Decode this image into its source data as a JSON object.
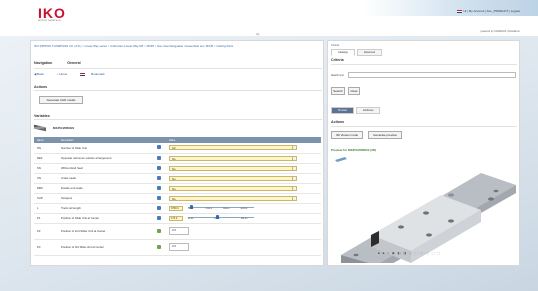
{
  "header": {
    "logo_text": "IKO",
    "logo_sub": "NIPPON THOMPSON",
    "user_line": "Hi | My Account | ALL_PRODUCT | Logout",
    "powered": "powered by CADENAS | Disclaimer",
    "center_mark": "top"
  },
  "breadcrumb": "IKO (NIPPON THOMPSON CO.,LTD.) > Linear Way series > 4-Direction Linear Way MX > MX35 > Non-interchangeable / Assembled set / MX35 > Casting Parts",
  "navigation": {
    "tabs": [
      "Navigation",
      "General"
    ],
    "links": [
      "Back",
      "Home",
      "Bookmark"
    ]
  },
  "actions_title": "Actions",
  "generate_cad_label": "Generate CAD model",
  "variables_title": "Variables",
  "part_name": "MX35C2R60HS",
  "table": {
    "headers": [
      "Name",
      "Description",
      "",
      "Value"
    ],
    "rows": [
      {
        "name": "NN",
        "desc": "Number of Slide Unit",
        "value": "C2"
      },
      {
        "name": "REF",
        "desc": "Opposite reference surface arrangement",
        "value": "No"
      },
      {
        "name": "SN",
        "desc": "Without End Seal",
        "value": "No"
      },
      {
        "name": "UN",
        "desc": "Under seals",
        "value": "No"
      },
      {
        "name": "DBS",
        "desc": "Double end seals",
        "value": "No"
      },
      {
        "name": "SUP",
        "desc": "Scrapers",
        "value": "No"
      },
      {
        "name": "L",
        "desc": "Track rail length",
        "value": "3760.0",
        "ticks": [
          "100.0",
          "1240.0",
          "2660.0",
          "4000.0"
        ]
      },
      {
        "name": "P1",
        "desc": "Position of Slide Unit at Center",
        "value": "174.0",
        "ticks": [
          "40.00",
          "116.0",
          "198.00"
        ]
      },
      {
        "name": "P2",
        "desc": "Position of 2nd Slider Unit at Center",
        "value": "0.0"
      },
      {
        "name": "P3",
        "desc": "Position of 3rd Slide Unit at Center",
        "value": "0.0"
      }
    ]
  },
  "right": {
    "link": "Criteria",
    "tabs": [
      "Catalogs",
      "Advanced"
    ],
    "criteria_title": "Criteria",
    "search_label": "Search text",
    "search_placeholder": "",
    "search_button": "Search",
    "clear_button": "Clear",
    "sub_tabs": [
      "Preview",
      "Attributes"
    ],
    "actions_title": "Actions",
    "view3d_button": "3D Viewer mode",
    "generate_preview_button": "Generate preview",
    "preview_title": "Preview for MX35C2R60HS (3D)",
    "toolbar_icons": "■ ■ □ ▣ ◧ ◨ ⬚ ⬚ ⬚ ⬚ ⬚ ⬚"
  },
  "colors": {
    "table_header": "#7c93ab",
    "value_field": "#fff6c8",
    "brand_red": "#c8102e"
  }
}
